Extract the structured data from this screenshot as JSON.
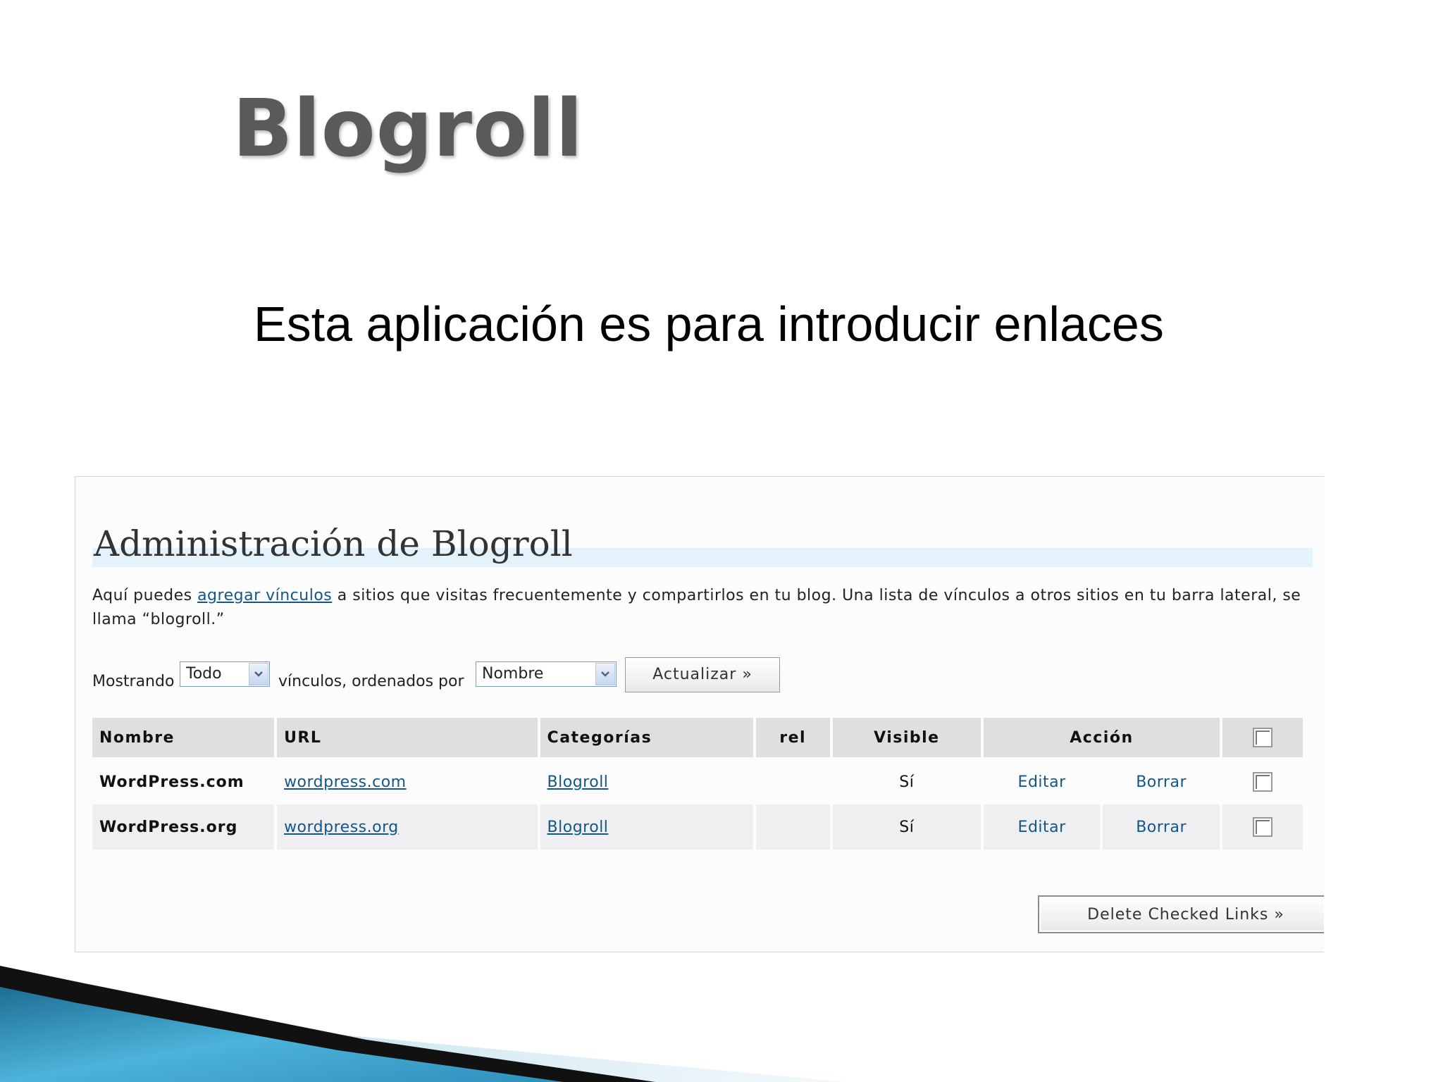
{
  "slide": {
    "title": "Blogroll",
    "subtitle": "Esta aplicación es para introducir enlaces"
  },
  "screenshot": {
    "heading": "Administración de Blogroll",
    "intro": {
      "before_link": "Aquí puedes ",
      "link": "agregar vínculos",
      "after_link": " a sitios que visitas frecuentemente y compartirlos en tu blog. Una lista de vínculos a otros sitios en tu barra lateral, se llama “blogroll.”"
    },
    "filter": {
      "label_showing": "Mostrando",
      "show_value": "Todo",
      "label_ordered": "vínculos, ordenados por",
      "order_value": "Nombre",
      "update_button": "Actualizar »"
    },
    "table": {
      "headers": {
        "name": "Nombre",
        "url": "URL",
        "categories": "Categorías",
        "rel": "rel",
        "visible": "Visible",
        "action": "Acción"
      },
      "rows": [
        {
          "name": "WordPress.com",
          "url": "wordpress.com",
          "category": "Blogroll",
          "rel": "",
          "visible": "Sí",
          "edit": "Editar",
          "delete": "Borrar",
          "checked": false
        },
        {
          "name": "WordPress.org",
          "url": "wordpress.org",
          "category": "Blogroll",
          "rel": "",
          "visible": "Sí",
          "edit": "Editar",
          "delete": "Borrar",
          "checked": false
        }
      ]
    },
    "delete_button": "Delete Checked Links »"
  },
  "colors": {
    "link": "#14568a",
    "header_bg": "#dfdfdf",
    "title_band": "#e4f2fb",
    "deco_blue": "#3b9cc8"
  }
}
